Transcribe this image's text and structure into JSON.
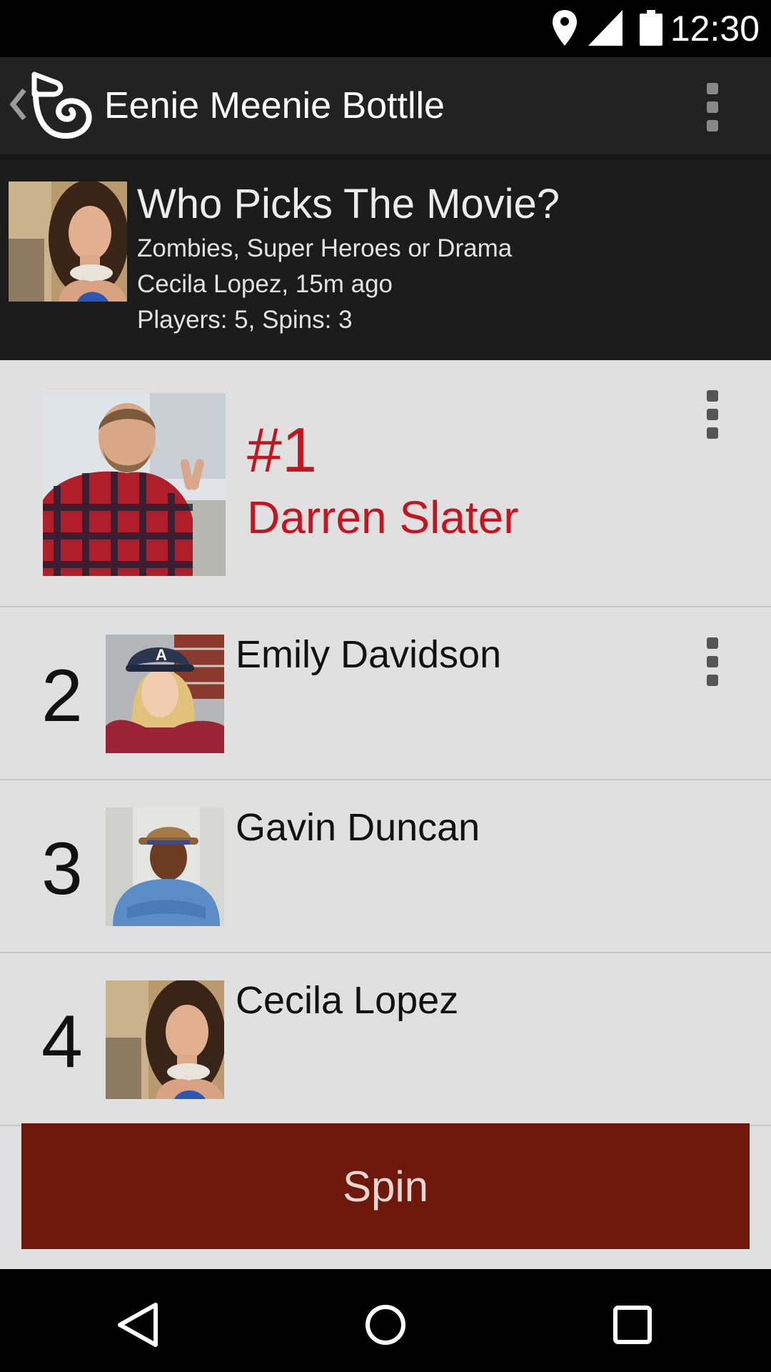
{
  "status_bar": {
    "time": "12:30",
    "icons": [
      "location-icon",
      "signal-icon",
      "battery-icon"
    ]
  },
  "app_bar": {
    "back_icon": "chevron-left-icon",
    "logo_icon": "bottle-logo-icon",
    "title": "Eenie Meenie Bottlle",
    "menu_icon": "overflow-menu-icon"
  },
  "game": {
    "title": "Who Picks The Movie?",
    "subtitle": "Zombies, Super Heroes or Drama",
    "creator_line": "Cecila Lopez, 15m ago",
    "stats_line": "Players: 5, Spins: 3"
  },
  "winner": {
    "rank": "#1",
    "name": "Darren Slater"
  },
  "players": [
    {
      "rank": "2",
      "name": "Emily Davidson"
    },
    {
      "rank": "3",
      "name": "Gavin Duncan"
    },
    {
      "rank": "4",
      "name": "Cecila Lopez"
    }
  ],
  "spin_label": "Spin",
  "colors": {
    "accent_red": "#c41620",
    "spin_button": "#6e170b",
    "list_background": "#e0e0e0",
    "header_background": "#1b1b1b",
    "app_bar": "#222222"
  },
  "nav_bar": {
    "icons": [
      "back-triangle-icon",
      "home-circle-icon",
      "recents-square-icon"
    ]
  }
}
